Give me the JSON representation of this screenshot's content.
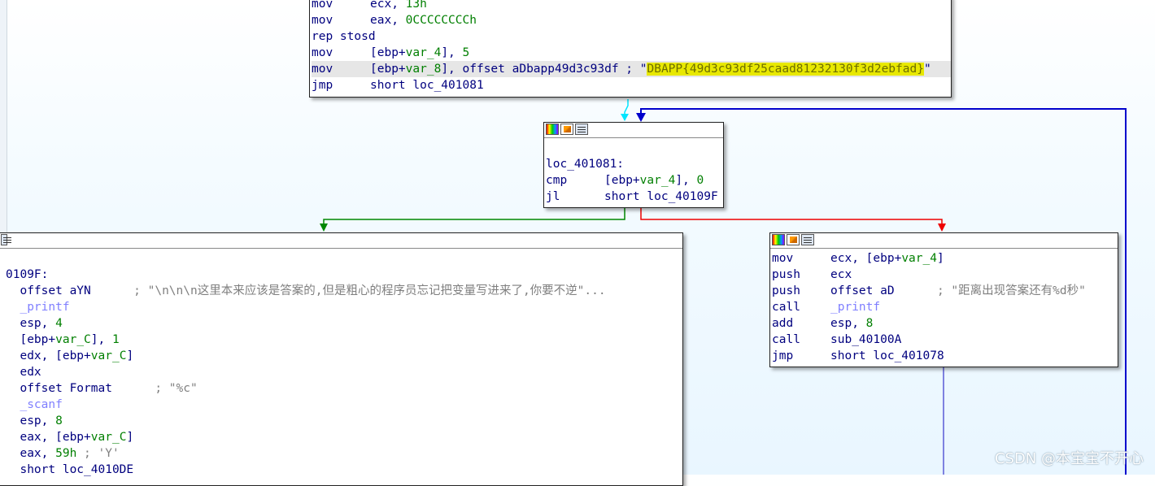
{
  "node_top": {
    "lines": [
      {
        "mn": "mov",
        "args": "ecx, ",
        "num": "13h"
      },
      {
        "mn": "mov",
        "args": "eax, ",
        "num": "0CCCCCCCCh"
      },
      {
        "mn": "rep stosd",
        "args": ""
      },
      {
        "mn": "mov",
        "pre": "[ebp+",
        "var": "var_4",
        "post": "], ",
        "num": "5"
      },
      {
        "mn": "mov",
        "pre": "[ebp+",
        "var": "var_8",
        "post": "], offset aDbapp49d3c93df ; \"",
        "str": "DBAPP{49d3c93df25caad81232130f3d2ebfad}",
        "tail": "\""
      },
      {
        "mn": "jmp",
        "args": "short loc_401081"
      }
    ]
  },
  "node_mid": {
    "label": "loc_401081:",
    "lines": [
      {
        "mn": "cmp",
        "pre": "[ebp+",
        "var": "var_4",
        "post": "], ",
        "num": "0"
      },
      {
        "mn": "jl",
        "args": "short loc_40109F"
      }
    ]
  },
  "node_left": {
    "label": "0109F:",
    "lines": [
      {
        "args": "offset aYN",
        "comment": "; \"\\n\\n\\n这里本来应该是答案的,但是粗心的程序员忘记把变量写进来了,你要不逆\"..."
      },
      {
        "fn": "_printf"
      },
      {
        "args": "esp, ",
        "num": "4"
      },
      {
        "pre": "[ebp+",
        "var": "var_C",
        "post": "], ",
        "num": "1"
      },
      {
        "pre": "edx, [ebp+",
        "var": "var_C",
        "post": "]"
      },
      {
        "args": "edx"
      },
      {
        "args": "offset Format",
        "comment": "; \"%c\""
      },
      {
        "fn": "_scanf"
      },
      {
        "args": "esp, ",
        "num": "8"
      },
      {
        "pre": "eax, [ebp+",
        "var": "var_C",
        "post": "]"
      },
      {
        "args": "eax, ",
        "num": "59h",
        "comment": " ; 'Y'"
      },
      {
        "args": "short loc_4010DE"
      }
    ]
  },
  "node_right": {
    "lines": [
      {
        "mn": "mov",
        "pre": "ecx, [ebp+",
        "var": "var_4",
        "post": "]"
      },
      {
        "mn": "push",
        "args": "ecx"
      },
      {
        "mn": "push",
        "args": "offset aD",
        "comment": "; \"距离出现答案还有%d秒\""
      },
      {
        "mn": "call",
        "fn": "_printf"
      },
      {
        "mn": "add",
        "args": "esp, ",
        "num": "8"
      },
      {
        "mn": "call",
        "args": "sub_40100A"
      },
      {
        "mn": "jmp",
        "args": "short loc_401078"
      }
    ]
  },
  "colors": {
    "true_edge": "#008800",
    "false_edge": "#ee0000",
    "flow_edge": "#0000cc",
    "entry_edge": "#00e5ff"
  },
  "watermark": "CSDN @本宝宝不开心"
}
